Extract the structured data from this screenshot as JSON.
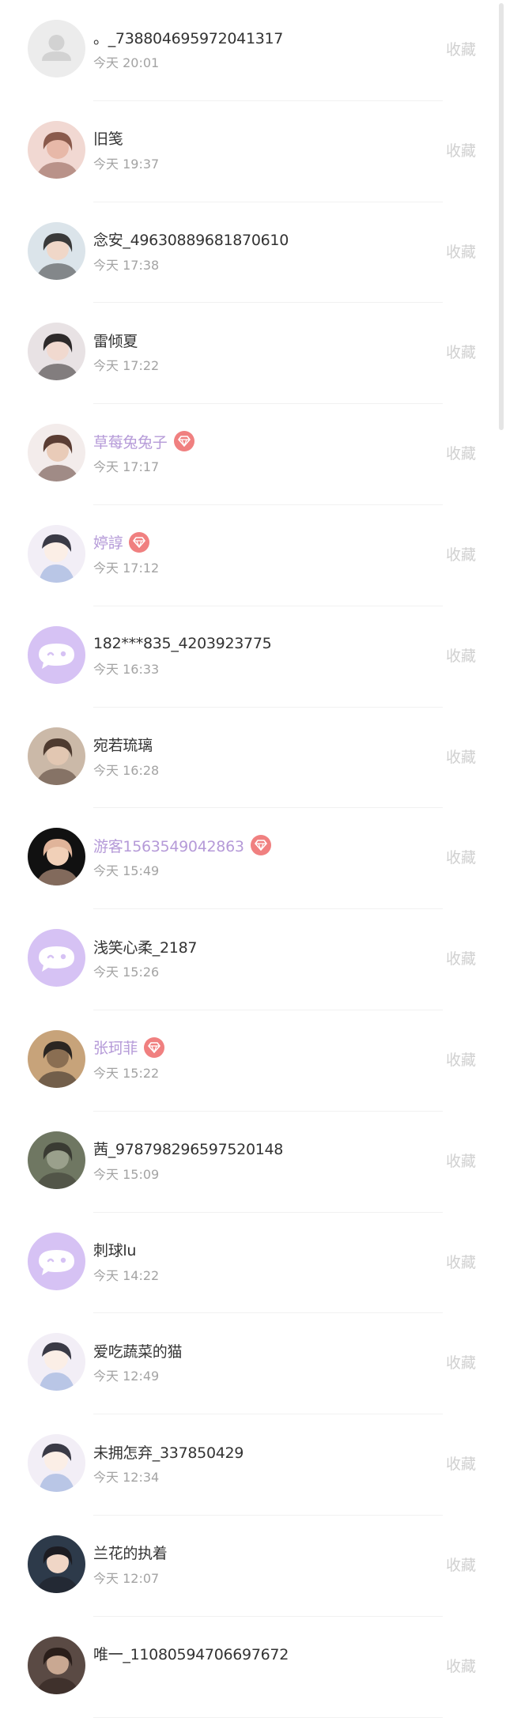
{
  "fav_label": "收藏",
  "colors": {
    "vip_name": "#b59ad8",
    "normal_name": "#333333",
    "time": "#a3a3a3",
    "fav": "#d0d0d0",
    "vip_badge": "#f08080",
    "app_avatar_bg": "#d6c2f4"
  },
  "items": [
    {
      "name": "。_738804695972041317",
      "time": "今天 20:01",
      "vip": false,
      "avatar": "default-person"
    },
    {
      "name": "旧笺",
      "time": "今天 19:37",
      "vip": false,
      "avatar": "photo"
    },
    {
      "name": "念安_496308896818706​10",
      "time": "今天 17:38",
      "vip": false,
      "avatar": "photo"
    },
    {
      "name": "雷倾夏",
      "time": "今天 17:22",
      "vip": false,
      "avatar": "photo"
    },
    {
      "name": "草莓兔兔子",
      "time": "今天 17:17",
      "vip": true,
      "avatar": "photo"
    },
    {
      "name": "婷諄",
      "time": "今天 17:12",
      "vip": true,
      "avatar": "illustration"
    },
    {
      "name": "182***835_4203923775",
      "time": "今天 16:33",
      "vip": false,
      "avatar": "app-default"
    },
    {
      "name": "宛若琉璃",
      "time": "今天 16:28",
      "vip": false,
      "avatar": "photo"
    },
    {
      "name": "游客1563549042863",
      "time": "今天 15:49",
      "vip": true,
      "avatar": "photo"
    },
    {
      "name": "浅笑心柔_2187",
      "time": "今天 15:26",
      "vip": false,
      "avatar": "app-default"
    },
    {
      "name": "张珂菲",
      "time": "今天 15:22",
      "vip": true,
      "avatar": "photo"
    },
    {
      "name": "茜_978798296597520148",
      "time": "今天 15:09",
      "vip": false,
      "avatar": "photo"
    },
    {
      "name": "刺球lu",
      "time": "今天 14:22",
      "vip": false,
      "avatar": "app-default"
    },
    {
      "name": "爱吃蔬菜的猫",
      "time": "今天 12:49",
      "vip": false,
      "avatar": "illustration"
    },
    {
      "name": "未拥怎弃_337850429",
      "time": "今天 12:34",
      "vip": false,
      "avatar": "illustration"
    },
    {
      "name": "兰花的执着",
      "time": "今天 12:07",
      "vip": false,
      "avatar": "photo"
    },
    {
      "name": "唯一_11080594706697672",
      "time": "",
      "vip": false,
      "avatar": "photo"
    }
  ]
}
